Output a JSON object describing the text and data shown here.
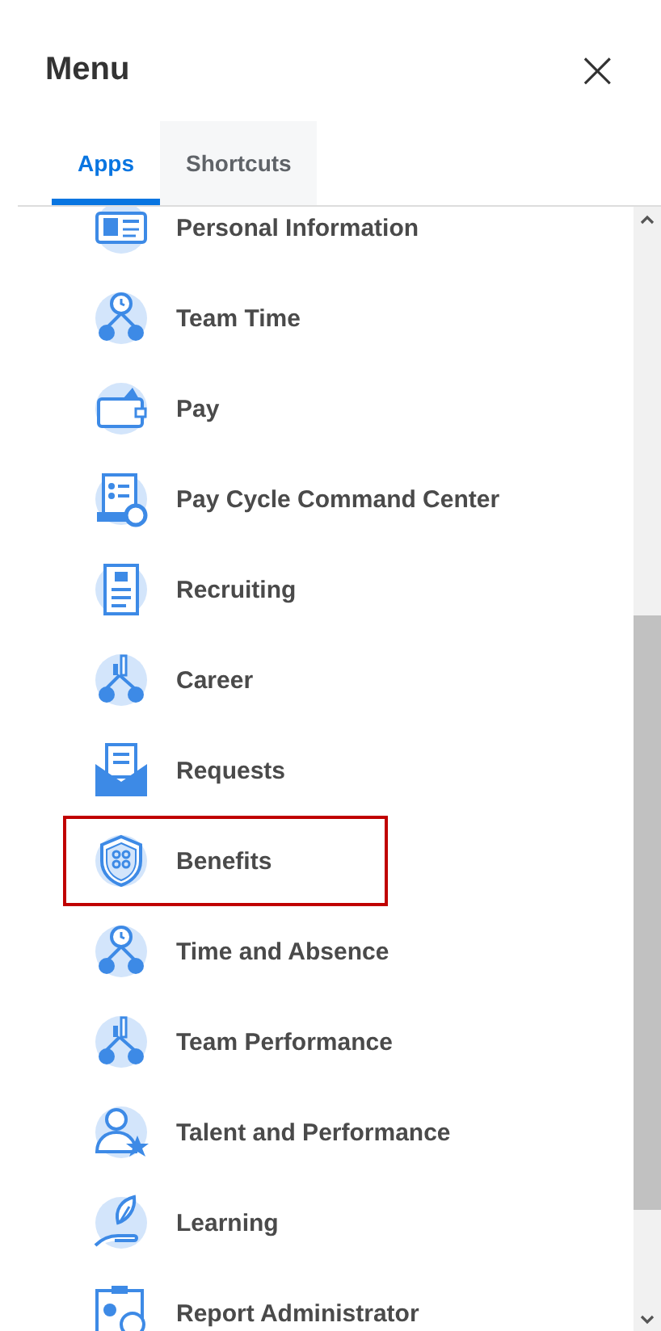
{
  "header": {
    "title": "Menu",
    "close": "×"
  },
  "tabs": [
    {
      "label": "Apps",
      "selected": true
    },
    {
      "label": "Shortcuts",
      "selected": false
    }
  ],
  "apps": [
    {
      "label": "Personal Information",
      "kind": "idcard",
      "highlighted": false
    },
    {
      "label": "Team Time",
      "kind": "teamclock",
      "highlighted": false
    },
    {
      "label": "Pay",
      "kind": "wallet",
      "highlighted": false
    },
    {
      "label": "Pay Cycle Command Center",
      "kind": "checklist",
      "highlighted": false
    },
    {
      "label": "Recruiting",
      "kind": "document",
      "highlighted": false
    },
    {
      "label": "Career",
      "kind": "teamchart",
      "highlighted": false
    },
    {
      "label": "Requests",
      "kind": "envelope",
      "highlighted": false
    },
    {
      "label": "Benefits",
      "kind": "shield",
      "highlighted": true
    },
    {
      "label": "Time and Absence",
      "kind": "teamclock",
      "highlighted": false
    },
    {
      "label": "Team Performance",
      "kind": "teamchart",
      "highlighted": false
    },
    {
      "label": "Talent and Performance",
      "kind": "personstar",
      "highlighted": false
    },
    {
      "label": "Learning",
      "kind": "leaf",
      "highlighted": false
    },
    {
      "label": "Report Administrator",
      "kind": "report",
      "highlighted": false
    }
  ]
}
